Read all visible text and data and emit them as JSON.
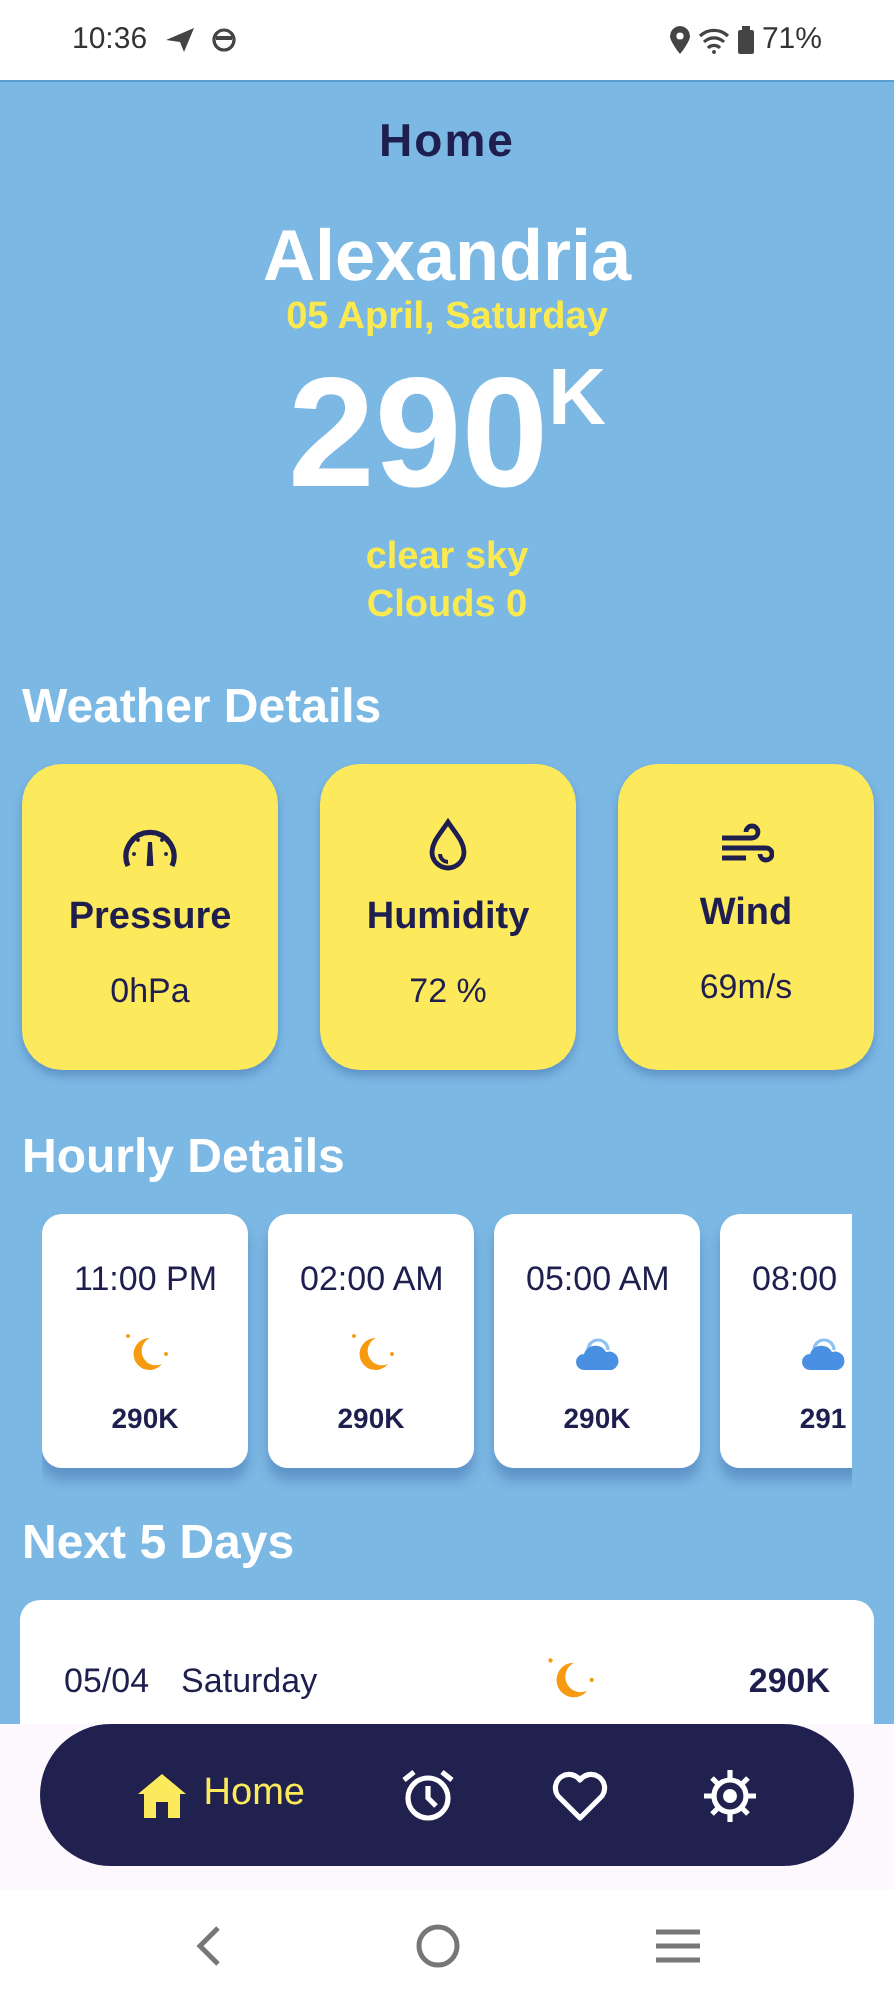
{
  "status_bar": {
    "time": "10:36",
    "battery": "71%"
  },
  "header": {
    "title": "Home"
  },
  "current": {
    "city": "Alexandria",
    "date": "05 April, Saturday",
    "temperature": "290",
    "unit": "K",
    "description": "clear sky",
    "clouds": "Clouds 0"
  },
  "weather_details": {
    "title": "Weather Details",
    "cards": [
      {
        "kind": "pressure",
        "label": "Pressure",
        "value": "0hPa"
      },
      {
        "kind": "humidity",
        "label": "Humidity",
        "value": "72 %"
      },
      {
        "kind": "wind",
        "label": "Wind",
        "value": "69m/s"
      }
    ]
  },
  "hourly_details": {
    "title": "Hourly Details",
    "items": [
      {
        "time": "11:00 PM",
        "kind": "moon",
        "temperature": "290K"
      },
      {
        "time": "02:00 AM",
        "kind": "moon",
        "temperature": "290K"
      },
      {
        "time": "05:00 AM",
        "kind": "cloud",
        "temperature": "290K"
      },
      {
        "time": "08:00",
        "kind": "cloud",
        "temperature": "291"
      }
    ]
  },
  "next_days": {
    "title": "Next 5 Days",
    "items": [
      {
        "date": "05/04",
        "day": "Saturday",
        "kind": "moon",
        "temperature": "290K"
      }
    ]
  },
  "bottom_nav": [
    {
      "kind": "home",
      "label": "Home",
      "selected": true
    },
    {
      "kind": "alarm",
      "selected": false
    },
    {
      "kind": "favorites",
      "selected": false
    },
    {
      "kind": "settings",
      "selected": false
    }
  ]
}
